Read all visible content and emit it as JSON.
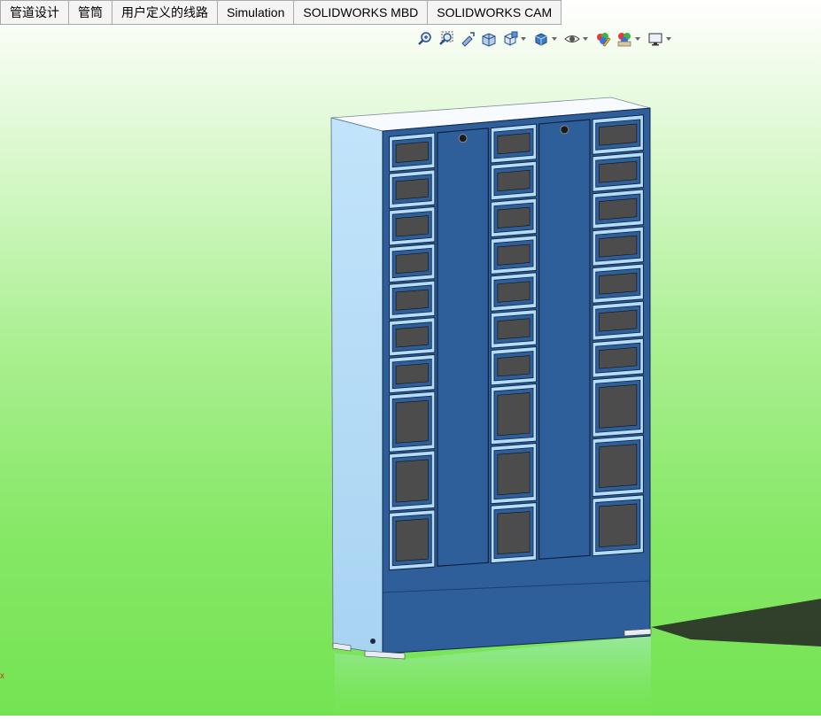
{
  "tabs": [
    {
      "label": "管道设计"
    },
    {
      "label": "管筒"
    },
    {
      "label": "用户定义的线路"
    },
    {
      "label": "Simulation"
    },
    {
      "label": "SOLIDWORKS MBD"
    },
    {
      "label": "SOLIDWORKS CAM"
    }
  ],
  "hud_toolbar": [
    {
      "icon": "zoom-to-fit-icon"
    },
    {
      "icon": "zoom-to-area-icon"
    },
    {
      "icon": "previous-view-icon"
    },
    {
      "icon": "section-view-icon"
    },
    {
      "icon": "view-orientation-icon",
      "dropdown": true
    },
    {
      "icon": "display-style-icon",
      "dropdown": true
    },
    {
      "icon": "hide-show-items-icon",
      "dropdown": true
    },
    {
      "icon": "edit-appearance-icon"
    },
    {
      "icon": "apply-scene-icon",
      "dropdown": true
    },
    {
      "icon": "view-settings-icon",
      "dropdown": true
    }
  ],
  "model": {
    "name": "locker-cabinet",
    "body_color": "#2f5f9a",
    "side_color": "#b3dcf6",
    "top_color": "#f7fbff",
    "door_color": "#4c4c4c",
    "column_rows": [
      [
        7,
        3
      ],
      [
        7,
        3
      ],
      [
        7,
        3
      ]
    ]
  },
  "triad_label": "x"
}
